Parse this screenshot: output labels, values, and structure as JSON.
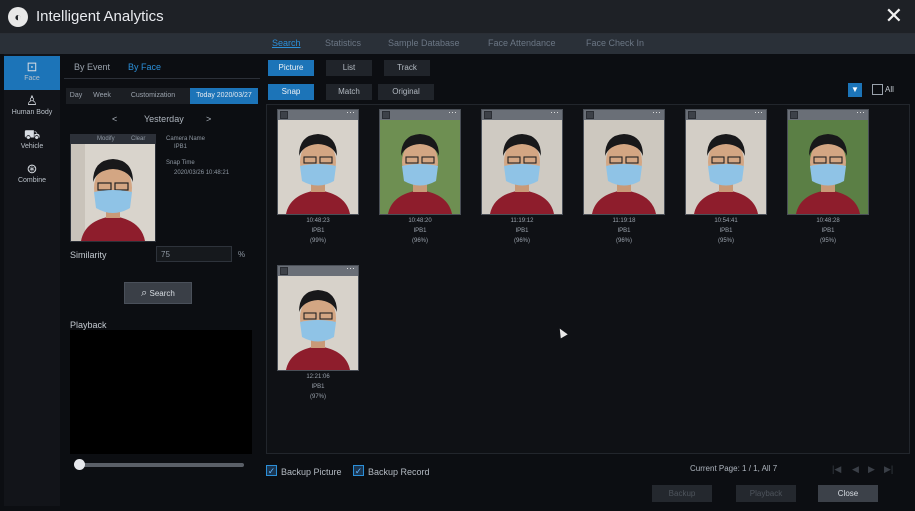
{
  "app": {
    "title": "Intelligent Analytics",
    "close_icon": "close-icon"
  },
  "topnav": [
    {
      "label": "Search",
      "active": true
    },
    {
      "label": "Statistics",
      "active": false
    },
    {
      "label": "Sample Database",
      "active": false
    },
    {
      "label": "Face Attendance",
      "active": false
    },
    {
      "label": "Face Check In",
      "active": false
    }
  ],
  "sidebar": [
    {
      "label": "Face",
      "icon": "face-icon",
      "active": true
    },
    {
      "label": "Human Body",
      "icon": "human-body-icon",
      "active": false
    },
    {
      "label": "Vehicle",
      "icon": "vehicle-icon",
      "active": false
    },
    {
      "label": "Combine",
      "icon": "combine-icon",
      "active": false
    }
  ],
  "left": {
    "tabs": [
      "By Event",
      "By Face"
    ],
    "day_buttons": [
      "Day",
      "Week",
      "Customization",
      "Today 2020/03/27"
    ],
    "day_nav": {
      "prev": "<",
      "label": "Yesterday",
      "next": ">"
    },
    "face_card": {
      "modify": "Modify",
      "clear": "Clear",
      "camera_name_label": "Camera Name",
      "camera_name_value": "IPB1",
      "snap_time_label": "Snap Time",
      "snap_time_value": "2020/03/26 10:48:21"
    },
    "similarity": {
      "label": "Similarity",
      "value": "75",
      "unit": "%"
    },
    "search_button": "Search",
    "playback_label": "Playback"
  },
  "right": {
    "view_tabs": [
      "Picture",
      "List",
      "Track"
    ],
    "source_tabs": [
      "Snap",
      "Match",
      "Original"
    ],
    "all_label": "All",
    "results": [
      {
        "time": "10:48:23",
        "camera": "IPB1",
        "score": "(99%)"
      },
      {
        "time": "10:48:20",
        "camera": "IPB1",
        "score": "(96%)"
      },
      {
        "time": "11:19:12",
        "camera": "IPB1",
        "score": "(96%)"
      },
      {
        "time": "11:19:18",
        "camera": "IPB1",
        "score": "(96%)"
      },
      {
        "time": "10:54:41",
        "camera": "IPB1",
        "score": "(95%)"
      },
      {
        "time": "10:48:28",
        "camera": "IPB1",
        "score": "(95%)"
      },
      {
        "time": "12:21:06",
        "camera": "IPB1",
        "score": "(97%)"
      }
    ],
    "backup_picture": "Backup Picture",
    "backup_record": "Backup Record",
    "page_info": "Current Page: 1 / 1, All 7",
    "buttons": {
      "backup": "Backup",
      "playback": "Playback",
      "close": "Close"
    }
  },
  "colors": {
    "accent": "#1c74b8",
    "mask": "#8fc3e6",
    "shirt": "#8e1d2c"
  }
}
